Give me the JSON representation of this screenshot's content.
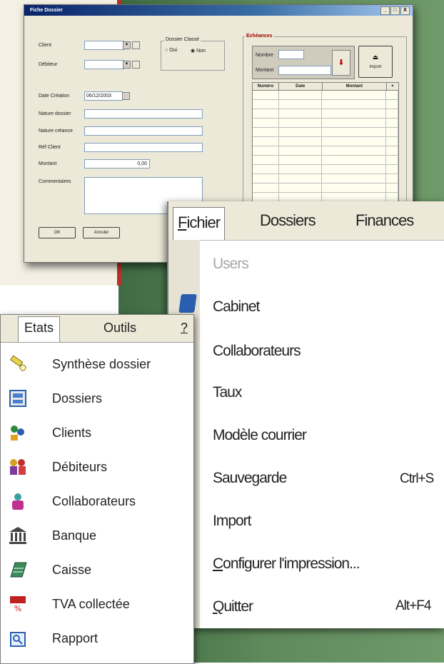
{
  "fiche": {
    "title": "Fiche Dossier",
    "win_buttons": [
      "_",
      "□",
      "X"
    ],
    "client_label": "Client",
    "debiteur_label": "Débiteur",
    "dossier_classe_label": "Dossier Classé",
    "oui_label": "Oui",
    "non_label": "Non",
    "date_creation_label": "Date Création",
    "date_creation_value": "06/12/2003",
    "nature_dossier_label": "Nature dossier",
    "nature_creance_label": "Nature créance",
    "ref_client_label": "Réf Client",
    "montant_label": "Montant",
    "montant_value": "0,00",
    "commentaires_label": "Commentaires",
    "ok_label": "OK",
    "annuler_label": "Annuler",
    "echeances_title": "Echéances",
    "nombre_label": "Nombre",
    "ech_montant_label": "Montant",
    "import_label": "Import",
    "grid_headers": [
      "Numéro",
      "Date",
      "Montant"
    ]
  },
  "menu_right": {
    "tabs": [
      "Fichier",
      "Dossiers",
      "Finances"
    ],
    "items": [
      {
        "label": "Users",
        "shortcut": "",
        "disabled": true
      },
      {
        "label": "Cabinet",
        "shortcut": ""
      },
      {
        "label": "Collaborateurs",
        "shortcut": ""
      },
      {
        "label": "Taux",
        "shortcut": ""
      },
      {
        "label": "Modèle courrier",
        "shortcut": ""
      },
      {
        "label": "Sauvegarde",
        "shortcut": "Ctrl+S"
      },
      {
        "label": "Import",
        "shortcut": ""
      },
      {
        "label": "Configurer l'impression...",
        "shortcut": ""
      },
      {
        "label": "Quitter",
        "shortcut": "Alt+F4"
      }
    ]
  },
  "menu_left": {
    "tabs": [
      "Etats",
      "Outils",
      "?"
    ],
    "items": [
      {
        "label": "Synthèse dossier",
        "icon": "flashlight-icon"
      },
      {
        "label": "Dossiers",
        "icon": "folder-icon"
      },
      {
        "label": "Clients",
        "icon": "clients-icon"
      },
      {
        "label": "Débiteurs",
        "icon": "debiteurs-icon"
      },
      {
        "label": "Collaborateurs",
        "icon": "collaborateurs-icon"
      },
      {
        "label": "Banque",
        "icon": "bank-icon"
      },
      {
        "label": "Caisse",
        "icon": "cash-register-icon"
      },
      {
        "label": "TVA collectée",
        "icon": "tva-icon"
      },
      {
        "label": "Rapport",
        "icon": "report-icon"
      }
    ]
  }
}
